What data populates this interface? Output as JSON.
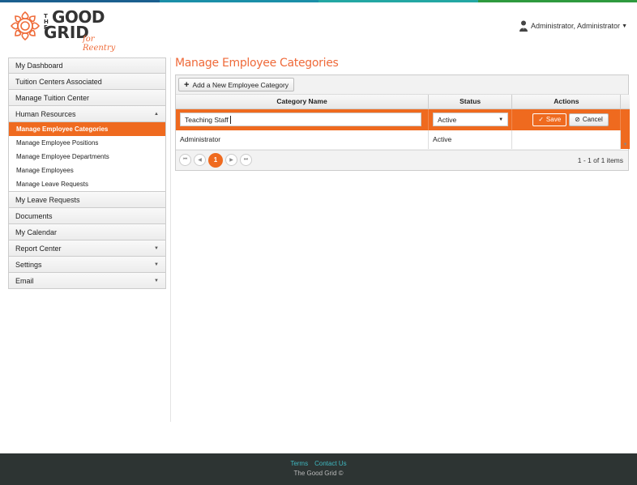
{
  "colors": {
    "topbar": [
      "#1b5f8f",
      "#1b8fa8",
      "#23a7a3",
      "#2e9a3e"
    ],
    "accent": "#ef6a1f",
    "footer_bg": "#2d3433",
    "footer_link": "#3fb8c0"
  },
  "logo": {
    "the": "THE",
    "good": "GOOD",
    "grid": "GRID",
    "tagline": "for Reentry"
  },
  "header": {
    "user_name": "Administrator, Administrator",
    "user_icon": "user-avatar-icon"
  },
  "sidebar": {
    "items_top": [
      {
        "label": "My Dashboard"
      },
      {
        "label": "Tuition Centers Associated"
      },
      {
        "label": "Manage Tuition Center"
      },
      {
        "label": "Human Resources",
        "expanded": true
      }
    ],
    "sub_items": [
      {
        "label": "Manage Employee Categories",
        "active": true
      },
      {
        "label": "Manage Employee Positions"
      },
      {
        "label": "Manage Employee Departments"
      },
      {
        "label": "Manage Employees"
      },
      {
        "label": "Manage Leave Requests"
      }
    ],
    "items_bottom": [
      {
        "label": "My Leave Requests"
      },
      {
        "label": "Documents"
      },
      {
        "label": "My Calendar"
      },
      {
        "label": "Report Center",
        "has_children": true
      },
      {
        "label": "Settings",
        "has_children": true
      },
      {
        "label": "Email",
        "has_children": true
      }
    ]
  },
  "main": {
    "title": "Manage Employee Categories",
    "add_button": "Add a New Employee Category",
    "columns": [
      "Category Name",
      "Status",
      "Actions"
    ],
    "edit_row": {
      "category_value": "Teaching Staff",
      "status_value": "Active",
      "save_label": "Save",
      "cancel_label": "Cancel"
    },
    "rows": [
      {
        "category": "Administrator",
        "status": "Active"
      }
    ],
    "pager": {
      "current_page": "1",
      "info": "1 - 1 of 1 items"
    }
  },
  "footer": {
    "terms": "Terms",
    "contact": "Contact Us",
    "copyright": "The Good Grid ©"
  }
}
